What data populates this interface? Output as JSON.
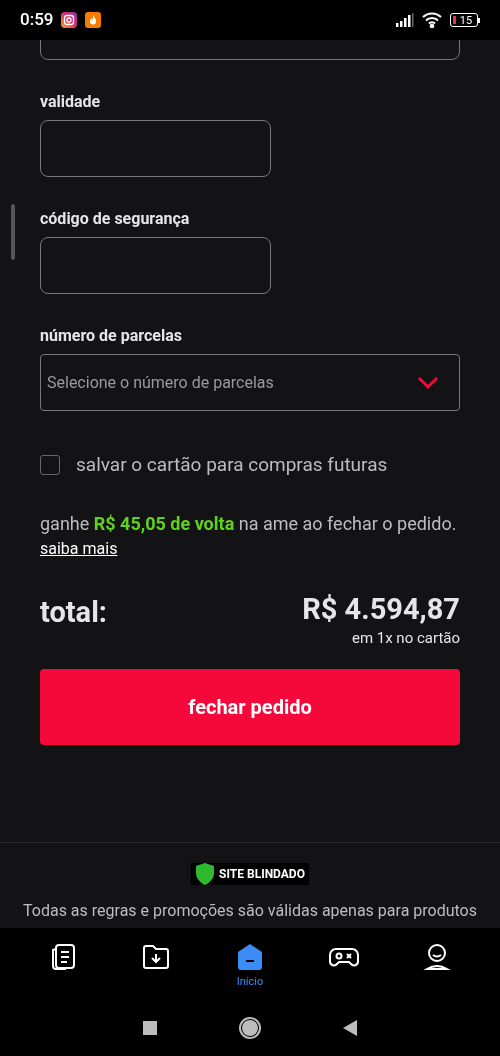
{
  "status_bar": {
    "time": "0:59",
    "battery": "15"
  },
  "fields": [
    {
      "label": "validade"
    },
    {
      "label": "código de segurança"
    }
  ],
  "installments": {
    "label": "número de parcelas",
    "placeholder": "Selecione o número de parcelas"
  },
  "save_card": {
    "label": "salvar o cartão para compras futuras",
    "checked": false
  },
  "cashback": {
    "text": "ganhe **R$ 45,05 de volta** na ame ao fechar o pedido.",
    "link": "saiba mais"
  },
  "total": {
    "label": "total:",
    "value": "R$ 4.594,87",
    "note": "em 1x no cartão"
  },
  "submit_button": "fechar pedido",
  "footer": {
    "badge": "SITE BLINDADO",
    "text": "Todas as regras e promoções são válidas apenas para produtos"
  },
  "bottom_nav": [
    {
      "kind": "documents",
      "selected": false
    },
    {
      "kind": "downloads",
      "selected": false
    },
    {
      "kind": "home",
      "label": "Início",
      "selected": true
    },
    {
      "kind": "games",
      "selected": false
    },
    {
      "kind": "profile",
      "selected": false
    }
  ]
}
